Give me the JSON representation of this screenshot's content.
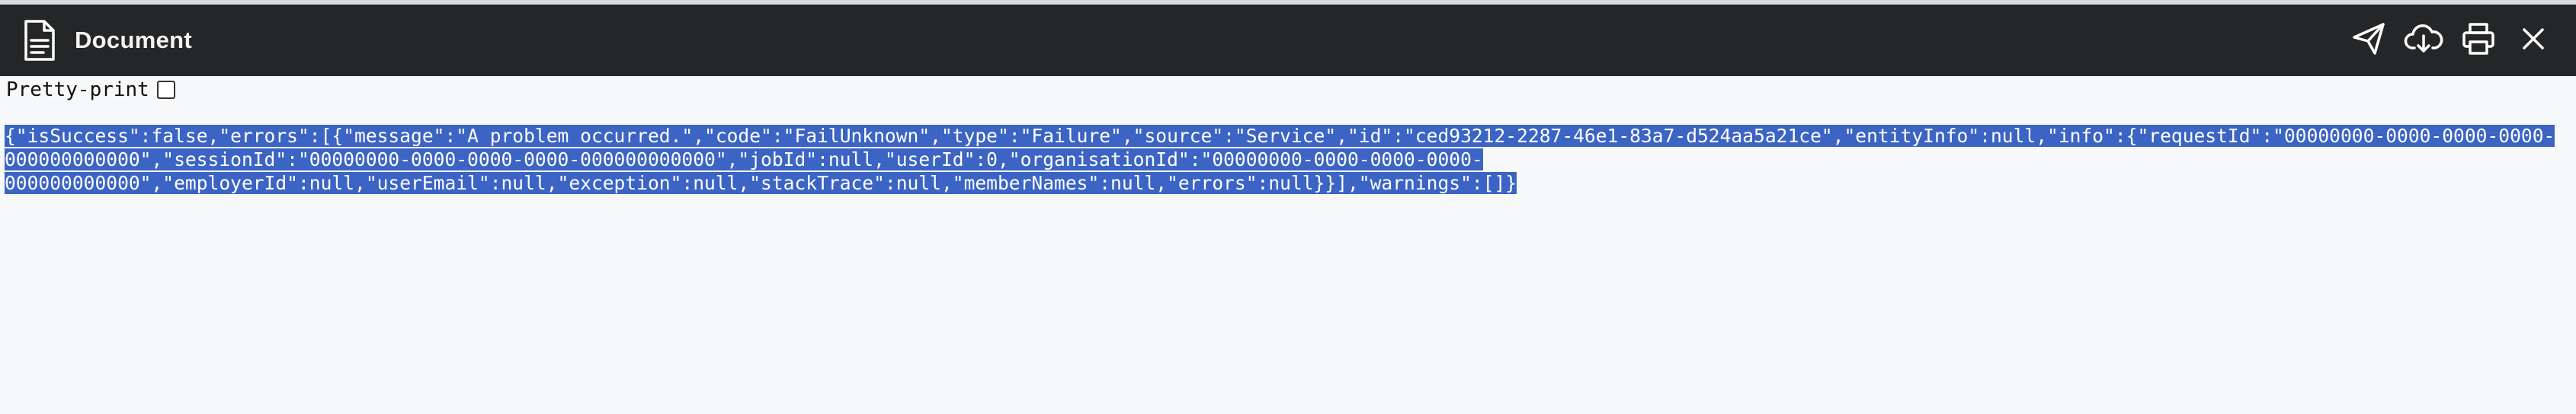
{
  "window": {
    "title": "Document"
  },
  "toolbar": {
    "pretty_print_label": "Pretty-print",
    "pretty_print_checked": false
  },
  "actions": {
    "send_icon": "paper-plane-icon",
    "download_icon": "cloud-download-icon",
    "print_icon": "printer-icon",
    "close_icon": "close-icon"
  },
  "content": {
    "lines": [
      "{\"isSuccess\":false,\"errors\":[{\"message\":\"A problem occurred.\",\"code\":\"FailUnknown\",\"type\":\"Failure\",\"source\":\"Service\",\"id\":\"ced93212-2287-46e1-83a7-d524aa5a21ce\",\"entityInfo\":null,\"info\":{\"requestId\":\"00000000-0000-0000-0000-",
      "000000000000\",\"sessionId\":\"00000000-0000-0000-0000-000000000000\",\"jobId\":null,\"userId\":0,\"organisationId\":\"00000000-0000-0000-0000-",
      "000000000000\",\"employerId\":null,\"userEmail\":null,\"exception\":null,\"stackTrace\":null,\"memberNames\":null,\"errors\":null}}],\"warnings\":[]}"
    ]
  },
  "colors": {
    "titlebar_bg": "#252627",
    "selection_bg": "#3b64c4",
    "page_bg": "#f7f8fa"
  }
}
